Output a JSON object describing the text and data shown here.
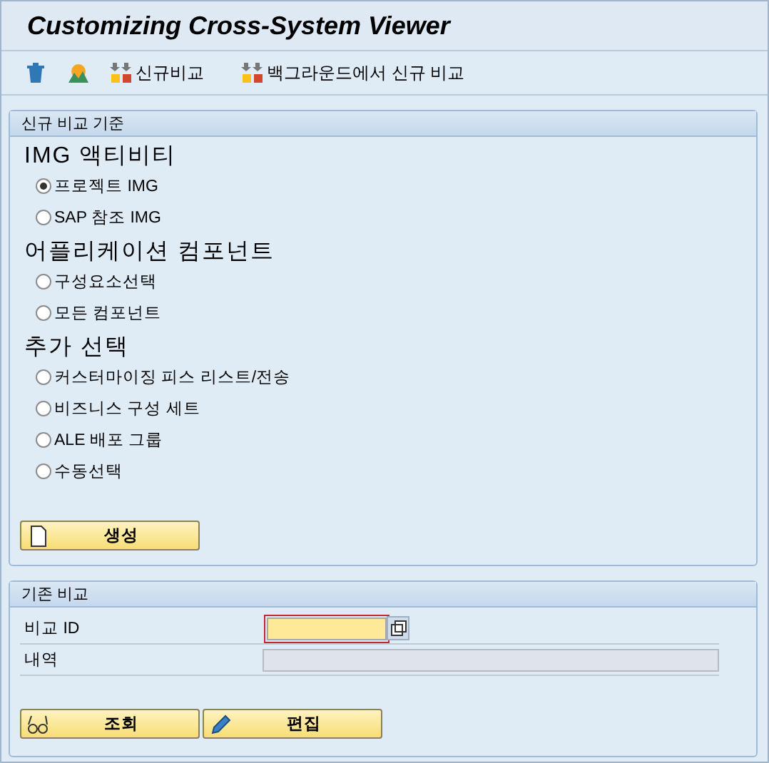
{
  "window": {
    "title": "Customizing Cross-System Viewer"
  },
  "toolbar": [
    {
      "kind": "trash"
    },
    {
      "kind": "landscape"
    },
    {
      "kind": "compare",
      "label": "신규비교"
    },
    {
      "kind": "compare",
      "label": "백그라운드에서 신규 비교"
    }
  ],
  "new_comparison": {
    "title": "신규 비교 기준",
    "sections": [
      {
        "heading": "IMG 액티비티",
        "options": [
          {
            "label": "프로젝트 IMG",
            "selected": true
          },
          {
            "label": "SAP 참조 IMG",
            "selected": false
          }
        ]
      },
      {
        "heading": "어플리케이션 컴포넌트",
        "options": [
          {
            "label": "구성요소선택",
            "selected": false
          },
          {
            "label": "모든 컴포넌트",
            "selected": false
          }
        ]
      },
      {
        "heading": "추가 선택",
        "options": [
          {
            "label": "커스터마이징 피스 리스트/전송",
            "selected": false
          },
          {
            "label": "비즈니스 구성 세트",
            "selected": false
          },
          {
            "label": "ALE 배포 그룹",
            "selected": false
          },
          {
            "label": "수동선택",
            "selected": false
          }
        ]
      }
    ],
    "buttons": [
      {
        "kind": "document",
        "label": "생성"
      }
    ]
  },
  "existing_comparison": {
    "title": "기존 비교",
    "fields": [
      {
        "label": "비교 ID",
        "required": true,
        "disabled": false
      },
      {
        "label": "내역",
        "required": false,
        "disabled": true
      }
    ],
    "buttons": [
      {
        "kind": "glasses",
        "label": "조회"
      },
      {
        "kind": "pencil",
        "label": "편집"
      }
    ]
  }
}
